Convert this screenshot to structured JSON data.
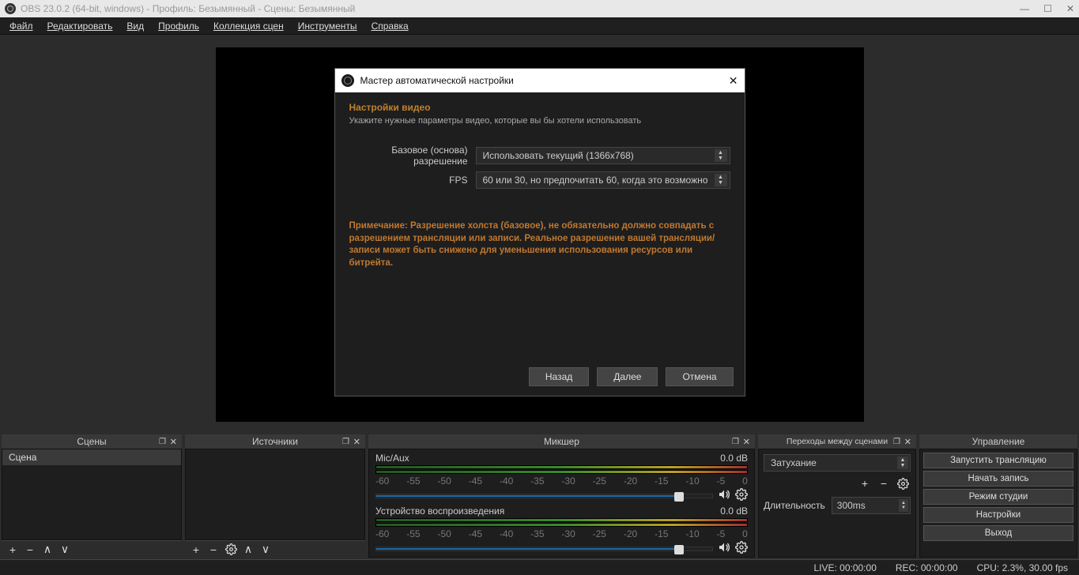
{
  "titlebar": {
    "text": "OBS 23.0.2 (64-bit, windows) - Профиль: Безымянный - Сцены: Безымянный"
  },
  "menu": {
    "items": [
      "Файл",
      "Редактировать",
      "Вид",
      "Профиль",
      "Коллекция сцен",
      "Инструменты",
      "Справка"
    ]
  },
  "dialog": {
    "title": "Мастер автоматической настройки",
    "section_title": "Настройки видео",
    "section_sub": "Укажите нужные параметры видео, которые вы бы хотели использовать",
    "rows": {
      "res_label": "Базовое (основа) разрешение",
      "res_value": "Использовать текущий (1366x768)",
      "fps_label": "FPS",
      "fps_value": "60 или 30, но предпочитать 60, когда это возможно"
    },
    "note": "Примечание: Разрешение холста (базовое), не обязательно должно совпадать с разрешением трансляции или записи. Реальное разрешение вашей трансляции/записи может быть снижено для уменьшения использования ресурсов или битрейта.",
    "buttons": {
      "back": "Назад",
      "next": "Далее",
      "cancel": "Отмена"
    }
  },
  "docks": {
    "scenes": {
      "title": "Сцены",
      "item": "Сцена"
    },
    "sources": {
      "title": "Источники"
    },
    "mixer": {
      "title": "Микшер",
      "channels": [
        {
          "name": "Mic/Aux",
          "level": "0.0 dB"
        },
        {
          "name": "Устройство воспроизведения",
          "level": "0.0 dB"
        }
      ],
      "ticks": [
        "-60",
        "-55",
        "-50",
        "-45",
        "-40",
        "-35",
        "-30",
        "-25",
        "-20",
        "-15",
        "-10",
        "-5",
        "0"
      ]
    },
    "transitions": {
      "title": "Переходы между сценами",
      "selected": "Затухание",
      "duration_label": "Длительность",
      "duration_value": "300ms"
    },
    "controls": {
      "title": "Управление",
      "buttons": [
        "Запустить трансляцию",
        "Начать запись",
        "Режим студии",
        "Настройки",
        "Выход"
      ]
    }
  },
  "statusbar": {
    "live": "LIVE: 00:00:00",
    "rec": "REC: 00:00:00",
    "cpu": "CPU: 2.3%, 30.00 fps"
  }
}
